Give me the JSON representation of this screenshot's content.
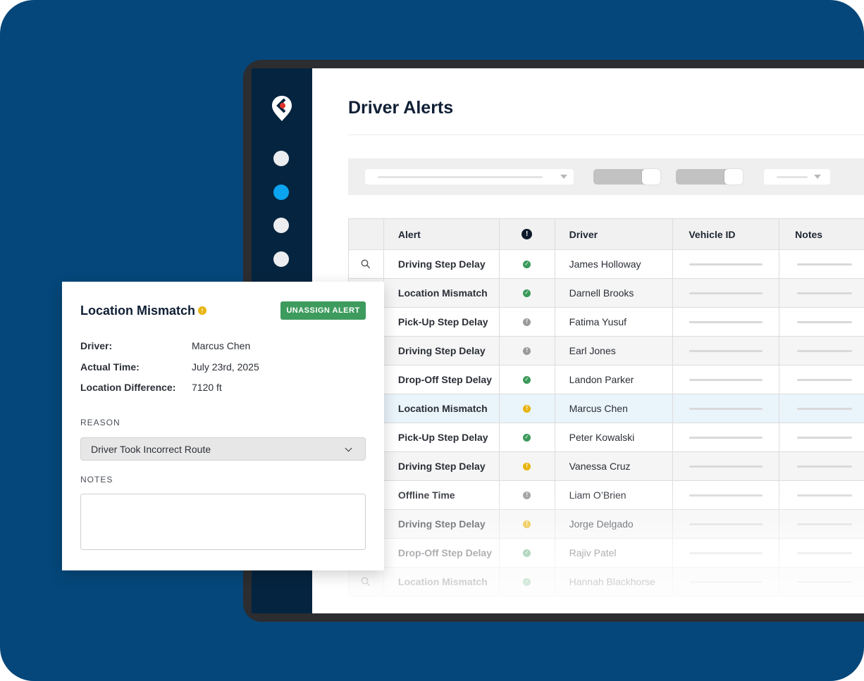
{
  "app": {
    "page_title": "Driver Alerts"
  },
  "colors": {
    "background": "#05477a",
    "rail": "#05243f",
    "rail_active": "#0aa4f0",
    "status_ok": "#3b9a5b",
    "status_warning": "#e8b40f",
    "status_neutral": "#9a9a9a",
    "unassign_button": "#3e9b5e",
    "highlight_row": "#eaf4fb"
  },
  "sidebar": {
    "logo_icon": "map-pin-logo-icon",
    "items": [
      {
        "icon": "nav-dot-icon",
        "active": false
      },
      {
        "icon": "nav-dot-icon",
        "active": true
      },
      {
        "icon": "nav-dot-icon",
        "active": false
      },
      {
        "icon": "nav-dot-icon",
        "active": false
      }
    ]
  },
  "table": {
    "headers": {
      "alert": "Alert",
      "status_icon": "!",
      "driver": "Driver",
      "vehicle_id": "Vehicle ID",
      "notes": "Notes"
    },
    "rows": [
      {
        "alert": "Driving Step Delay",
        "status": "ok",
        "driver": "James Holloway"
      },
      {
        "alert": "Location Mismatch",
        "status": "ok",
        "driver": "Darnell Brooks"
      },
      {
        "alert": "Pick-Up Step Delay",
        "status": "neutral",
        "driver": "Fatima Yusuf"
      },
      {
        "alert": "Driving Step Delay",
        "status": "neutral",
        "driver": "Earl Jones"
      },
      {
        "alert": "Drop-Off Step Delay",
        "status": "ok",
        "driver": "Landon Parker"
      },
      {
        "alert": "Location Mismatch",
        "status": "warning",
        "driver": "Marcus Chen"
      },
      {
        "alert": "Pick-Up Step Delay",
        "status": "ok",
        "driver": "Peter Kowalski"
      },
      {
        "alert": "Driving Step Delay",
        "status": "warning",
        "driver": "Vanessa Cruz"
      },
      {
        "alert": "Offline Time",
        "status": "neutral",
        "driver": "Liam O’Brien"
      },
      {
        "alert": "Driving Step Delay",
        "status": "warning",
        "driver": "Jorge Delgado"
      },
      {
        "alert": "Drop-Off Step Delay",
        "status": "ok",
        "driver": "Rajiv Patel"
      },
      {
        "alert": "Location Mismatch",
        "status": "ok",
        "driver": "Hannah Blackhorse"
      }
    ]
  },
  "detail": {
    "title": "Location Mismatch",
    "unassign_label": "UNASSIGN ALERT",
    "fields": [
      {
        "label": "Driver:",
        "value": "Marcus Chen"
      },
      {
        "label": "Actual Time:",
        "value": "July 23rd, 2025"
      },
      {
        "label": "Location Difference:",
        "value": "7120 ft"
      }
    ],
    "reason_label": "REASON",
    "reason_value": "Driver Took Incorrect Route",
    "notes_label": "NOTES",
    "notes_value": ""
  }
}
